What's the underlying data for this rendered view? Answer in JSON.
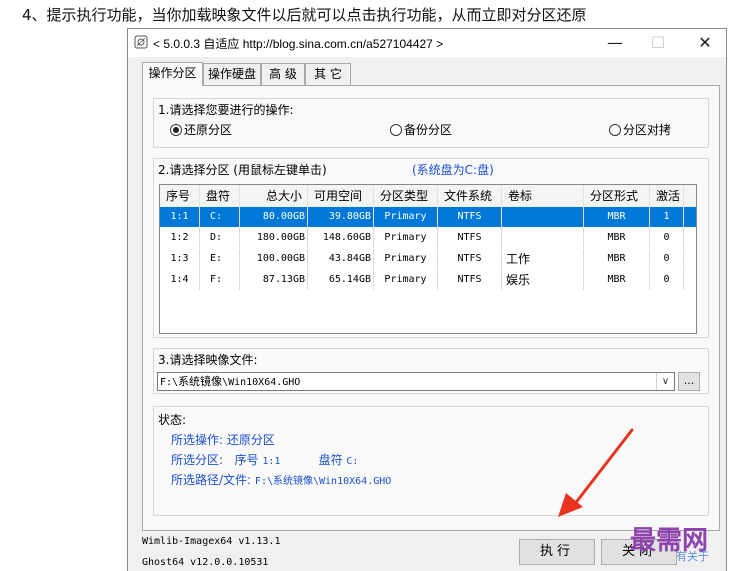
{
  "doc_heading": "4、提示执行功能，当你加载映象文件以后就可以点击执行功能，从而立即对分区还原",
  "window": {
    "title": "< 5.0.0.3 自适应 http://blog.sina.com.cn/a527104427 >",
    "minimize": "—",
    "maximize": "☐",
    "close": "✕"
  },
  "tabs": [
    "操作分区",
    "操作硬盘",
    "高 级",
    "其 它"
  ],
  "operation": {
    "label": "1.请选择您要进行的操作:",
    "options": [
      "还原分区",
      "备份分区",
      "分区对拷"
    ],
    "selected": 0
  },
  "partition": {
    "label": "2.请选择分区 (用鼠标左键单击)",
    "hint": "(系统盘为C:盘)",
    "columns": [
      "序号",
      "盘符",
      "总大小",
      "可用空间",
      "分区类型",
      "文件系统",
      "卷标",
      "分区形式",
      "激活"
    ],
    "rows": [
      [
        "1:1",
        "C:",
        "80.00GB",
        "39.80GB",
        "Primary",
        "NTFS",
        "",
        "MBR",
        "1"
      ],
      [
        "1:2",
        "D:",
        "180.00GB",
        "148.60GB",
        "Primary",
        "NTFS",
        "",
        "MBR",
        "0"
      ],
      [
        "1:3",
        "E:",
        "100.00GB",
        "43.84GB",
        "Primary",
        "NTFS",
        "工作",
        "MBR",
        "0"
      ],
      [
        "1:4",
        "F:",
        "87.13GB",
        "65.14GB",
        "Primary",
        "NTFS",
        "娱乐",
        "MBR",
        "0"
      ]
    ],
    "selected_row": 0
  },
  "image_file": {
    "label": "3.请选择映像文件:",
    "value_prefix": "F:\\",
    "value_cjk": "系统镜像",
    "value_suffix": "\\Win10X64.GHO",
    "browse": "..."
  },
  "status": {
    "label": "状态:",
    "op_label": "所选操作: 还原分区",
    "part_label": "所选分区:",
    "part_index_label": "序号",
    "part_index": "1:1",
    "part_drive_label": "盘符",
    "part_drive": "C:",
    "path_label": "所选路径/文件:",
    "path_value": "F:\\系统镜像\\Win10X64.GHO"
  },
  "footer": {
    "wimlib": "Wimlib-Imagex64 v1.13.1",
    "ghost": "Ghost64 v12.0.0.10531",
    "execute": "执行",
    "close": "关闭"
  },
  "watermark": {
    "brand": "最需网",
    "sub": "有关于"
  },
  "colors": {
    "selection": "#0078d7",
    "status_text": "#1c4fd1",
    "arrow": "#e8321e",
    "watermark": "#8e44ad"
  }
}
